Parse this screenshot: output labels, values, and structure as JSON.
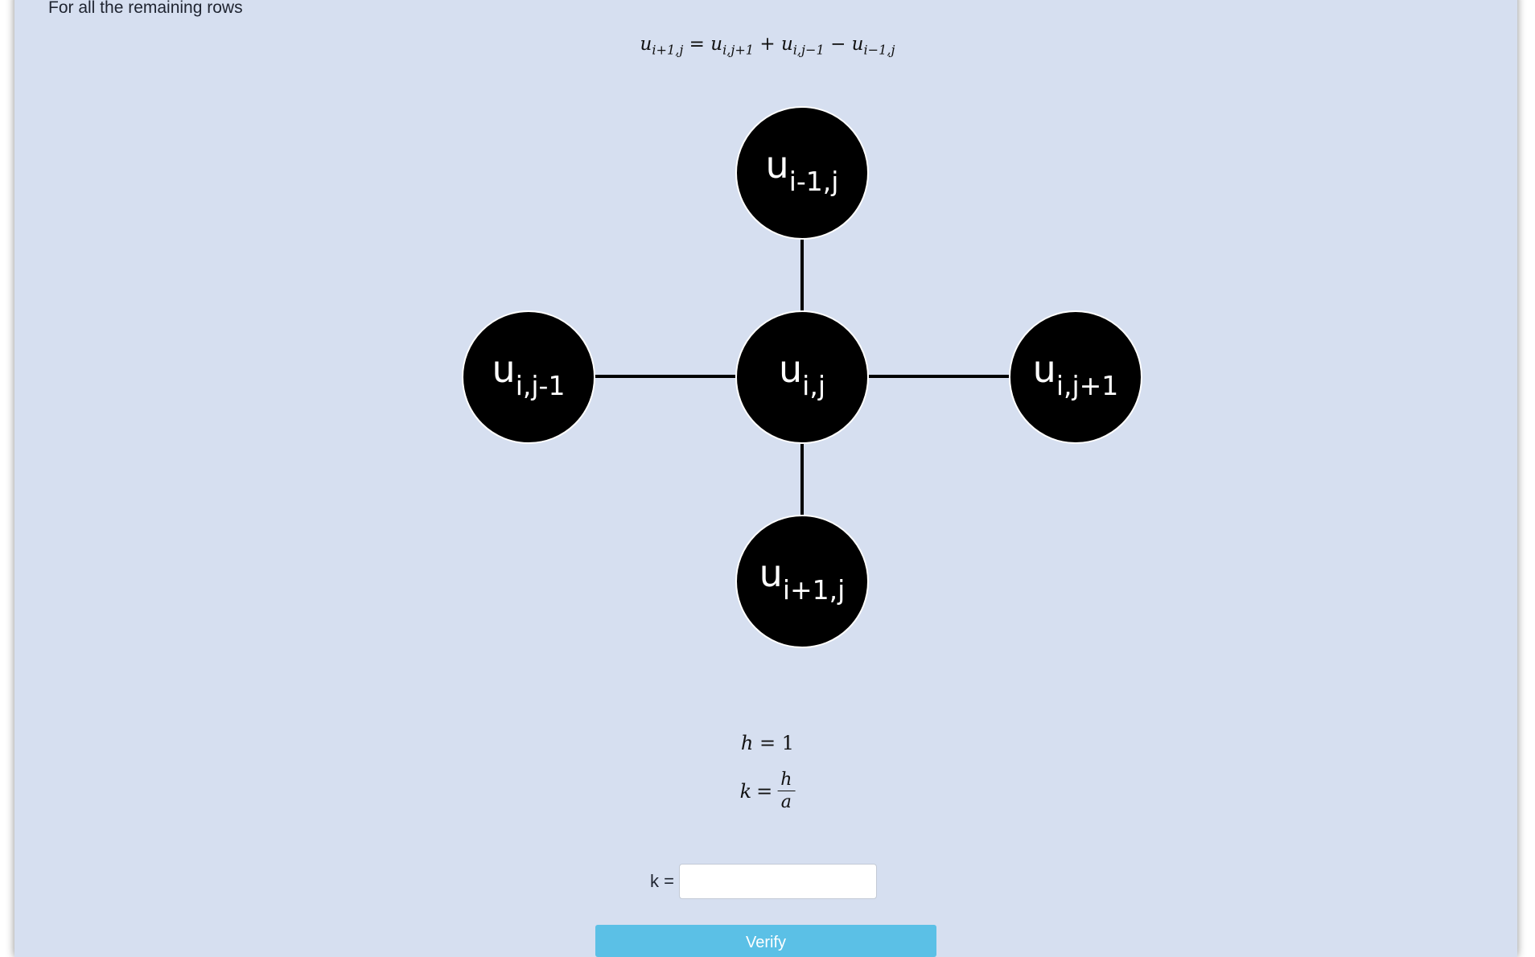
{
  "section_heading": "For all the remaining rows",
  "main_formula": {
    "lhs": {
      "var": "u",
      "sub": "i+1,j"
    },
    "eq": "=",
    "t1": {
      "var": "u",
      "sub": "i,j+1"
    },
    "op1": "+",
    "t2": {
      "var": "u",
      "sub": "i,j−1"
    },
    "op2": "−",
    "t3": {
      "var": "u",
      "sub": "i−1,j"
    }
  },
  "stencil": {
    "top": {
      "base": "u",
      "sub": "i-1,j"
    },
    "left": {
      "base": "u",
      "sub": "i,j-1"
    },
    "center": {
      "base": "u",
      "sub": "i,j"
    },
    "right": {
      "base": "u",
      "sub": "i,j+1"
    },
    "bottom": {
      "base": "u",
      "sub": "i+1,j"
    }
  },
  "h_equation": {
    "var": "h",
    "eq": "=",
    "value": "1"
  },
  "k_equation": {
    "var": "k",
    "eq": "=",
    "num": "h",
    "den": "a"
  },
  "k_field": {
    "label": "k =",
    "value": "",
    "placeholder": ""
  },
  "verify_button": {
    "label": "Verify"
  },
  "colors": {
    "panel_bg": "#d6dff0",
    "node_fill": "#000000",
    "node_text": "#ffffff",
    "verify_bg": "#5bc0e6"
  }
}
